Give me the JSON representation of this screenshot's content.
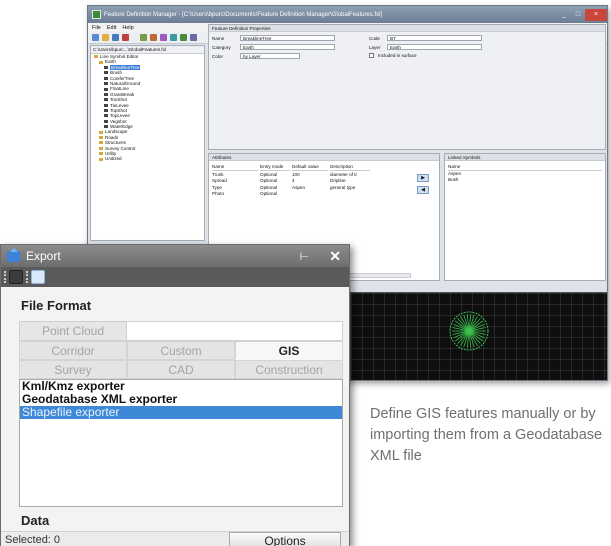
{
  "fdm": {
    "title": "Feature Definition Manager - [C:\\Users\\bpurc\\Documents\\Feature Definition Manager\\GlobalFeatures.fxl]",
    "menu": [
      "File",
      "Edit",
      "Help"
    ],
    "window_buttons": [
      "_",
      "□",
      "×"
    ],
    "tree": {
      "header": "C:\\Users\\bpurc...\\GlobalFeatures.fxl",
      "items": [
        {
          "label": "Line Symbol Editor",
          "indent": 0
        },
        {
          "label": "Earth",
          "indent": 1
        },
        {
          "label": "BreaklineTree",
          "indent": 2,
          "selected": true
        },
        {
          "label": "Brush",
          "indent": 2
        },
        {
          "label": "ConiferTree",
          "indent": 2
        },
        {
          "label": "NaturalGround",
          "indent": 2
        },
        {
          "label": "FloatLine",
          "indent": 2
        },
        {
          "label": "GrassBreak",
          "indent": 2
        },
        {
          "label": "TooShot",
          "indent": 2
        },
        {
          "label": "TieLevee",
          "indent": 2
        },
        {
          "label": "TopShot",
          "indent": 2
        },
        {
          "label": "TopLevee",
          "indent": 2
        },
        {
          "label": "Vegshot",
          "indent": 2
        },
        {
          "label": "WaterEdge",
          "indent": 2
        },
        {
          "label": "Landscape",
          "indent": 1
        },
        {
          "label": "Roads",
          "indent": 1
        },
        {
          "label": "Structures",
          "indent": 1
        },
        {
          "label": "Survey Control",
          "indent": 1
        },
        {
          "label": "Utility",
          "indent": 1
        },
        {
          "label": "Unitized",
          "indent": 1
        }
      ]
    },
    "properties": {
      "header": "Feature Definition Properties",
      "name_label": "Name",
      "name_value": "BreaklineTree",
      "code_label": "Code",
      "code_value": "BT",
      "category_label": "Category",
      "category_value": "Earth",
      "layer_label": "Layer",
      "layer_value": "Earth",
      "color_label": "Color",
      "color_value": "by Layer",
      "surface_label": "Included in surface"
    },
    "attributes": {
      "header": "Attributes",
      "columns": [
        "Name",
        "Entry mode",
        "Default value",
        "Description"
      ],
      "rows": [
        [
          "Trunk",
          "Optional",
          "100",
          "diameter of tr"
        ],
        [
          "Spread",
          "Optional",
          "4",
          "Dripline"
        ],
        [
          "Type",
          "Optional",
          "Aspen",
          "general type"
        ],
        [
          "Photo",
          "Optional",
          "",
          ""
        ]
      ]
    },
    "symbols": {
      "header": "Linked Symbols",
      "column": "Name",
      "items": [
        "Aspen",
        "Bush"
      ]
    }
  },
  "export": {
    "title": "Export",
    "pin": "⊢",
    "close": "✕",
    "file_format_title": "File Format",
    "point_cloud": "Point Cloud",
    "tabs": [
      "Corridor",
      "Custom",
      "GIS",
      "Survey",
      "CAD",
      "Construction"
    ],
    "active_tab": "GIS",
    "exporters": [
      "Kml/Kmz exporter",
      "Geodatabase XML exporter",
      "Shapefile exporter"
    ],
    "selected_exporter": "Shapefile exporter",
    "data_title": "Data",
    "selected_text": "Selected: 0",
    "options_label": "Options"
  },
  "caption": "Define GIS features manually or by importing them from a Geodatabase XML file",
  "colors": {
    "accent": "#3d89d8",
    "caption": "#6f6f6f",
    "preview_bg": "#0e0e0e",
    "preview_symbol": "#39c24a"
  }
}
